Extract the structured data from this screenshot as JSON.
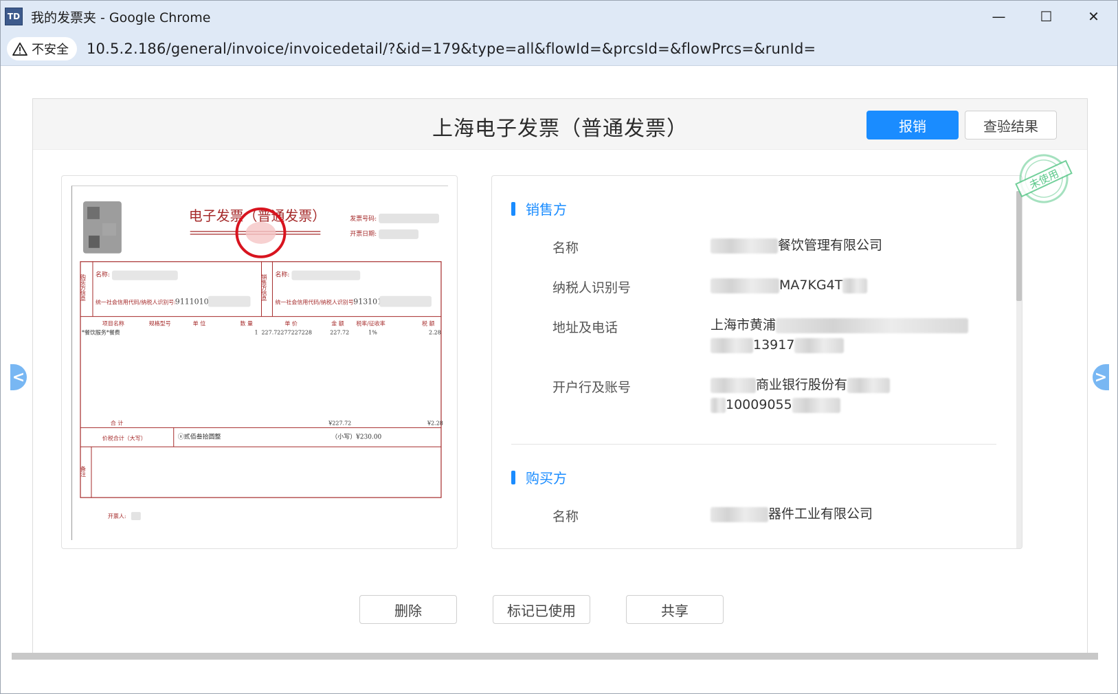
{
  "window": {
    "app_icon_text": "TD",
    "title": "我的发票夹 - Google Chrome",
    "minimize_symbol": "—",
    "maximize_symbol": "☐",
    "close_symbol": "✕"
  },
  "addressbar": {
    "security_label": "不安全",
    "url_host": "10.5.2.186",
    "url_path": "/general/invoice/invoicedetail/?&id=179&type=all&flowId=&prcsId=&flowPrcs=&runId="
  },
  "card": {
    "title": "上海电子发票（普通发票）",
    "reimburse_label": "报销",
    "check_result_label": "查验结果",
    "stamp_text": "未使用"
  },
  "invoice_image": {
    "heading": "电子发票（普通发票）",
    "invoice_no_label": "发票号码:",
    "issue_date_label": "开票日期:",
    "buyer_side_label": "购买方信息",
    "seller_side_label": "销售方信息",
    "name_label": "名称:",
    "tax_id_label": "统一社会信用代码/纳税人识别号:",
    "buyer_tax_visible": "91110108",
    "seller_tax_visible": "913101",
    "col_item": "项目名称",
    "col_spec": "规格型号",
    "col_unit": "单 位",
    "col_qty": "数 量",
    "col_price": "单 价",
    "col_amount": "金 额",
    "col_rate": "税率/征收率",
    "col_tax": "税 额",
    "item_name": "*餐饮服务*餐费",
    "item_qty": "1",
    "item_price": "227.72277227228",
    "item_amount": "227.72",
    "item_rate": "1%",
    "item_tax": "2.28",
    "total_label": "合 计",
    "total_amount": "¥227.72",
    "total_tax": "¥2.28",
    "grand_total_label": "价税合计（大写）",
    "grand_total_words": "ⓧ贰佰叁拾圆整",
    "grand_total_small": "（小写）¥230.00",
    "remark_label": "备注",
    "issuer_label": "开票人:"
  },
  "seller": {
    "section_title": "销售方",
    "name_label": "名称",
    "name_value": "餐饮管理有限公司",
    "tax_label": "纳税人识别号",
    "tax_value": "MA7KG4T",
    "address_label": "地址及电话",
    "address_value_line1": "上海市黄浦",
    "address_value_line2": "13917",
    "bank_label": "开户行及账号",
    "bank_value_line1": "商业银行股份有",
    "bank_value_line2": "10009055"
  },
  "buyer": {
    "section_title": "购买方",
    "name_label": "名称",
    "name_value": "器件工业有限公司"
  },
  "nav": {
    "prev_symbol": "<",
    "next_symbol": ">"
  },
  "actions": {
    "delete_label": "删除",
    "mark_used_label": "标记已使用",
    "share_label": "共享"
  },
  "colors": {
    "primary": "#1a8cff",
    "stamp_green": "#5bc88a",
    "invoice_red": "#a52a2a"
  }
}
